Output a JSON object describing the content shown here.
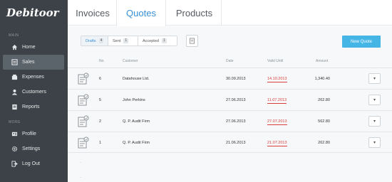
{
  "app": {
    "logo": "Debitoor"
  },
  "sidebar": {
    "main_label": "MAIN",
    "more_label": "MORE",
    "items": [
      {
        "label": "Home",
        "icon": "home-icon",
        "active": false
      },
      {
        "label": "Sales",
        "icon": "sales-icon",
        "active": true
      },
      {
        "label": "Expenses",
        "icon": "expenses-icon",
        "active": false
      },
      {
        "label": "Customers",
        "icon": "customers-icon",
        "active": false
      },
      {
        "label": "Reports",
        "icon": "reports-icon",
        "active": false
      }
    ],
    "more_items": [
      {
        "label": "Profile",
        "icon": "profile-icon"
      },
      {
        "label": "Settings",
        "icon": "settings-icon"
      },
      {
        "label": "Log Out",
        "icon": "logout-icon"
      }
    ]
  },
  "tabs": [
    {
      "label": "Invoices",
      "active": false
    },
    {
      "label": "Quotes",
      "active": true
    },
    {
      "label": "Products",
      "active": false
    }
  ],
  "filters": [
    {
      "label": "Drafts",
      "count": "4",
      "active": true
    },
    {
      "label": "Sent",
      "count": "1",
      "active": false
    },
    {
      "label": "Accepted",
      "count": "1",
      "active": false
    }
  ],
  "new_quote_label": "New Quote",
  "table": {
    "headers": {
      "no": "No.",
      "customer": "Customer",
      "date": "Date",
      "valid_until": "Valid Until",
      "amount": "Amount"
    },
    "rows": [
      {
        "no": "6",
        "customer": "Datahouse Ltd.",
        "date": "30.09.2013",
        "valid_until": "14.10.2013",
        "amount": "1,340.40"
      },
      {
        "no": "5",
        "customer": "John Perkins",
        "date": "27.06.2013",
        "valid_until": "11.07.2013",
        "amount": "262.80"
      },
      {
        "no": "2",
        "customer": "Q. P. Audit Firm",
        "date": "27.06.2013",
        "valid_until": "27.07.2013",
        "amount": "562.80"
      },
      {
        "no": "1",
        "customer": "Q. P. Audit Firm",
        "date": "21.06.2013",
        "valid_until": "21.07.2013",
        "amount": "262.80"
      }
    ]
  },
  "colors": {
    "accent": "#3a8fd6",
    "button": "#45b5e6",
    "overdue": "#d93d3d",
    "sidebar": "#3c4247"
  }
}
